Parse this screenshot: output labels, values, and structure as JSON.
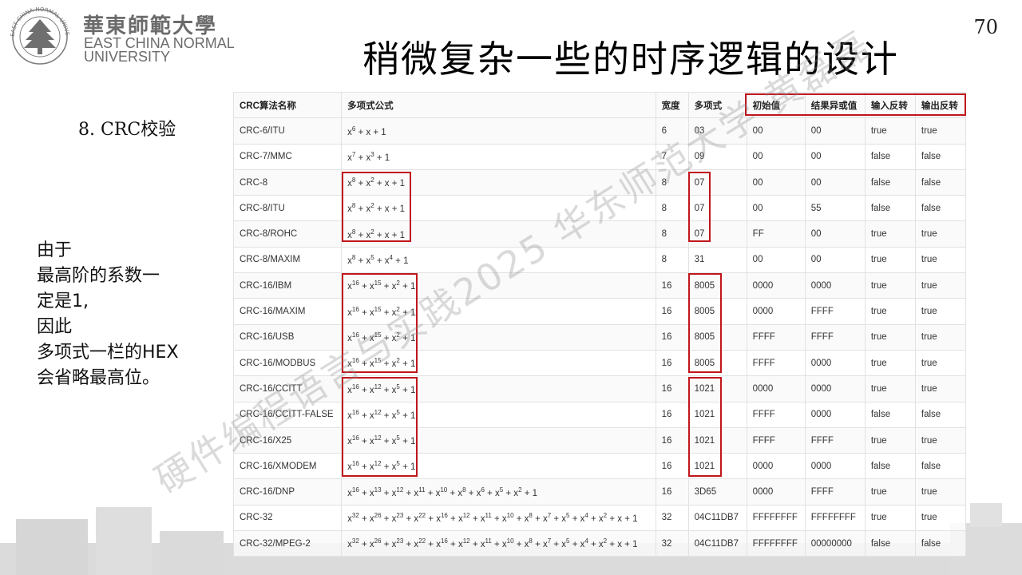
{
  "header": {
    "logo_cn": "華東師範大學",
    "logo_en_line1": "EAST CHINA NORMAL",
    "logo_en_line2": "UNIVERSITY",
    "emblem_ring_text": "EAST CHINA NORMAL UNIVERSITY",
    "page_number": "70",
    "title": "稍微复杂一些的时序逻辑的设计"
  },
  "section_label": "8. CRC校验",
  "note_lines": [
    "由于",
    "最高阶的系数一",
    "定是1,",
    "因此",
    "多项式一栏的HEX",
    "会省略最高位。"
  ],
  "watermark": "硬件编程语言与实践2025 华东师范大学 黄磊磊",
  "colors": {
    "highlight": "#c0161c",
    "table_border": "#e2e2e2",
    "logo_gray": "#6b6b6b"
  },
  "table": {
    "headers": [
      "CRC算法名称",
      "多项式公式",
      "宽度",
      "多项式",
      "初始值",
      "结果异或值",
      "输入反转",
      "输出反转"
    ],
    "rows": [
      {
        "name": "CRC-6/ITU",
        "formula_html": "x<sup>6</sup> + x + 1",
        "width": "6",
        "poly": "03",
        "init": "00",
        "xorout": "00",
        "refin": "true",
        "refout": "true"
      },
      {
        "name": "CRC-7/MMC",
        "formula_html": "x<sup>7</sup> + x<sup>3</sup> + 1",
        "width": "7",
        "poly": "09",
        "init": "00",
        "xorout": "00",
        "refin": "false",
        "refout": "false"
      },
      {
        "name": "CRC-8",
        "formula_html": "x<sup>8</sup> + x<sup>2</sup> + x + 1",
        "width": "8",
        "poly": "07",
        "init": "00",
        "xorout": "00",
        "refin": "false",
        "refout": "false"
      },
      {
        "name": "CRC-8/ITU",
        "formula_html": "x<sup>8</sup> + x<sup>2</sup> + x + 1",
        "width": "8",
        "poly": "07",
        "init": "00",
        "xorout": "55",
        "refin": "false",
        "refout": "false"
      },
      {
        "name": "CRC-8/ROHC",
        "formula_html": "x<sup>8</sup> + x<sup>2</sup> + x + 1",
        "width": "8",
        "poly": "07",
        "init": "FF",
        "xorout": "00",
        "refin": "true",
        "refout": "true"
      },
      {
        "name": "CRC-8/MAXIM",
        "formula_html": "x<sup>8</sup> + x<sup>5</sup> + x<sup>4</sup> + 1",
        "width": "8",
        "poly": "31",
        "init": "00",
        "xorout": "00",
        "refin": "true",
        "refout": "true"
      },
      {
        "name": "CRC-16/IBM",
        "formula_html": "x<sup>16</sup> + x<sup>15</sup> + x<sup>2</sup> + 1",
        "width": "16",
        "poly": "8005",
        "init": "0000",
        "xorout": "0000",
        "refin": "true",
        "refout": "true"
      },
      {
        "name": "CRC-16/MAXIM",
        "formula_html": "x<sup>16</sup> + x<sup>15</sup> + x<sup>2</sup> + 1",
        "width": "16",
        "poly": "8005",
        "init": "0000",
        "xorout": "FFFF",
        "refin": "true",
        "refout": "true"
      },
      {
        "name": "CRC-16/USB",
        "formula_html": "x<sup>16</sup> + x<sup>15</sup> + x<sup>2</sup> + 1",
        "width": "16",
        "poly": "8005",
        "init": "FFFF",
        "xorout": "FFFF",
        "refin": "true",
        "refout": "true"
      },
      {
        "name": "CRC-16/MODBUS",
        "formula_html": "x<sup>16</sup> + x<sup>15</sup> + x<sup>2</sup> + 1",
        "width": "16",
        "poly": "8005",
        "init": "FFFF",
        "xorout": "0000",
        "refin": "true",
        "refout": "true"
      },
      {
        "name": "CRC-16/CCITT",
        "formula_html": "x<sup>16</sup> + x<sup>12</sup> + x<sup>5</sup> + 1",
        "width": "16",
        "poly": "1021",
        "init": "0000",
        "xorout": "0000",
        "refin": "true",
        "refout": "true"
      },
      {
        "name": "CRC-16/CCITT-FALSE",
        "formula_html": "x<sup>16</sup> + x<sup>12</sup> + x<sup>5</sup> + 1",
        "width": "16",
        "poly": "1021",
        "init": "FFFF",
        "xorout": "0000",
        "refin": "false",
        "refout": "false"
      },
      {
        "name": "CRC-16/X25",
        "formula_html": "x<sup>16</sup> + x<sup>12</sup> + x<sup>5</sup> + 1",
        "width": "16",
        "poly": "1021",
        "init": "FFFF",
        "xorout": "FFFF",
        "refin": "true",
        "refout": "true"
      },
      {
        "name": "CRC-16/XMODEM",
        "formula_html": "x<sup>16</sup> + x<sup>12</sup> + x<sup>5</sup> + 1",
        "width": "16",
        "poly": "1021",
        "init": "0000",
        "xorout": "0000",
        "refin": "false",
        "refout": "false"
      },
      {
        "name": "CRC-16/DNP",
        "formula_html": "x<sup>16</sup> + x<sup>13</sup> + x<sup>12</sup> + x<sup>11</sup> + x<sup>10</sup> + x<sup>8</sup> + x<sup>6</sup> + x<sup>5</sup> + x<sup>2</sup> + 1",
        "width": "16",
        "poly": "3D65",
        "init": "0000",
        "xorout": "FFFF",
        "refin": "true",
        "refout": "true"
      },
      {
        "name": "CRC-32",
        "formula_html": "x<sup>32</sup> + x<sup>26</sup> + x<sup>23</sup> + x<sup>22</sup> + x<sup>16</sup> + x<sup>12</sup> + x<sup>11</sup> + x<sup>10</sup> + x<sup>8</sup> + x<sup>7</sup> + x<sup>5</sup> + x<sup>4</sup> + x<sup>2</sup> + x + 1",
        "width": "32",
        "poly": "04C11DB7",
        "init": "FFFFFFFF",
        "xorout": "FFFFFFFF",
        "refin": "true",
        "refout": "true"
      },
      {
        "name": "CRC-32/MPEG-2",
        "formula_html": "x<sup>32</sup> + x<sup>26</sup> + x<sup>23</sup> + x<sup>22</sup> + x<sup>16</sup> + x<sup>12</sup> + x<sup>11</sup> + x<sup>10</sup> + x<sup>8</sup> + x<sup>7</sup> + x<sup>5</sup> + x<sup>4</sup> + x<sup>2</sup> + x + 1",
        "width": "32",
        "poly": "04C11DB7",
        "init": "FFFFFFFF",
        "xorout": "00000000",
        "refin": "false",
        "refout": "false"
      }
    ]
  }
}
